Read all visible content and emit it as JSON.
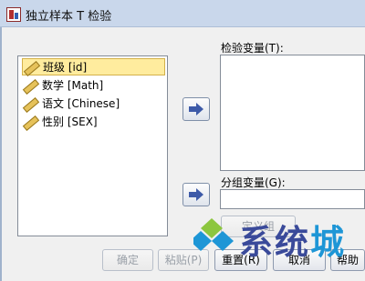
{
  "window": {
    "title": "独立样本 T 检验"
  },
  "variables": [
    {
      "label": "班级 [id]",
      "icon": "scale-ruler-icon",
      "selected": true
    },
    {
      "label": "数学 [Math]",
      "icon": "scale-ruler-icon",
      "selected": false
    },
    {
      "label": "语文 [Chinese]",
      "icon": "scale-ruler-icon",
      "selected": false
    },
    {
      "label": "性别 [SEX]",
      "icon": "scale-ruler-icon",
      "selected": false
    }
  ],
  "test_variables": {
    "label": "检验变量(T):"
  },
  "grouping_variable": {
    "label": "分组变量(G):",
    "value": ""
  },
  "buttons": {
    "define_groups": "定义组",
    "ok": "确定",
    "paste": "粘贴(P)",
    "reset": "重置(R)",
    "cancel": "取消",
    "help": "帮助"
  },
  "watermark": {
    "text_main": "系统",
    "text_accent": "城"
  },
  "colors": {
    "selection": "#ffec9e",
    "arrow": "#3d5aa8",
    "titlebar": "#c9d7eb"
  }
}
